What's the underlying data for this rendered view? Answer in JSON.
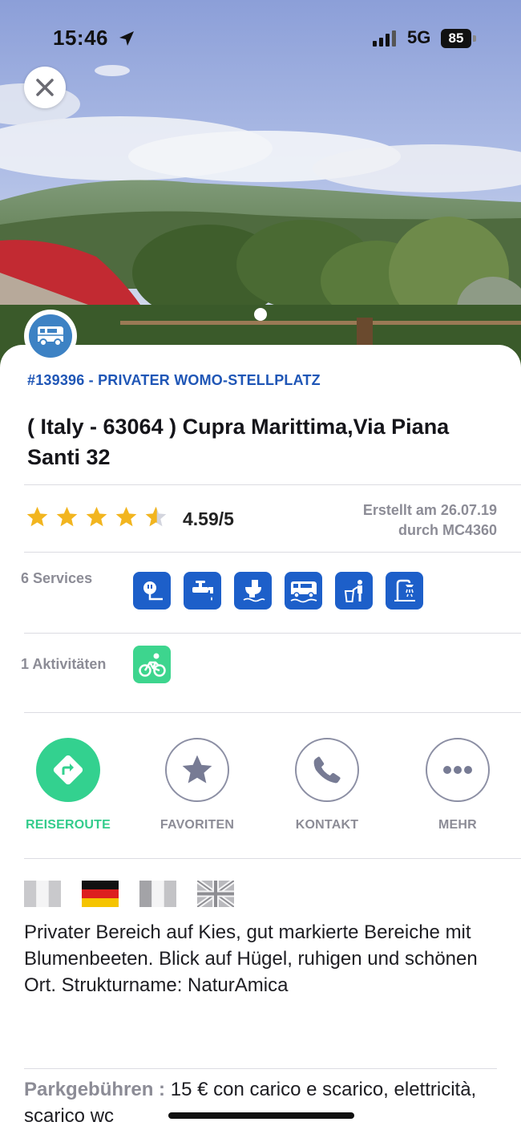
{
  "status_bar": {
    "time": "15:46",
    "network": "5G",
    "battery": "85",
    "icons": [
      "location-arrow-icon",
      "signal-bars-icon"
    ]
  },
  "hero": {
    "close_icon": "close-icon",
    "type_icon": "camper-van-icon",
    "slides_dots": 1
  },
  "spot": {
    "id_line": "#139396 - PRIVATER WOMO-STELLPLATZ",
    "title": "( Italy - 63064 ) Cupra Marittima,Via Piana Santi 32"
  },
  "rating": {
    "stars": 4.59,
    "value_text": "4.59/5",
    "created_line1": "Erstellt am 26.07.19",
    "created_line2": "durch MC4360",
    "star_color": "#f2b51f"
  },
  "services": {
    "label": "6 Services",
    "icons": [
      "electricity-icon",
      "water-tap-icon",
      "toilet-disposal-icon",
      "motorhome-service-icon",
      "waste-bin-icon",
      "shower-icon"
    ],
    "color": "#1d5fc9"
  },
  "activities": {
    "label": "1 Aktivitäten",
    "icons": [
      "cycling-icon"
    ],
    "color": "#3dd58e"
  },
  "actions": {
    "route": "REISEROUTE",
    "favorites": "FAVORITEN",
    "contact": "KONTAKT",
    "more": "MEHR",
    "accent": "#33d18f"
  },
  "languages": [
    "it",
    "de",
    "fr",
    "en"
  ],
  "description": "Privater Bereich auf Kies, gut markierte Bereiche mit Blumenbeeten. Blick auf Hügel, ruhigen und schönen Ort. Strukturname: NaturAmica",
  "fees": {
    "label": "Parkgebühren :",
    "value": "15 € con carico e scarico, elettricità, scarico wc"
  }
}
